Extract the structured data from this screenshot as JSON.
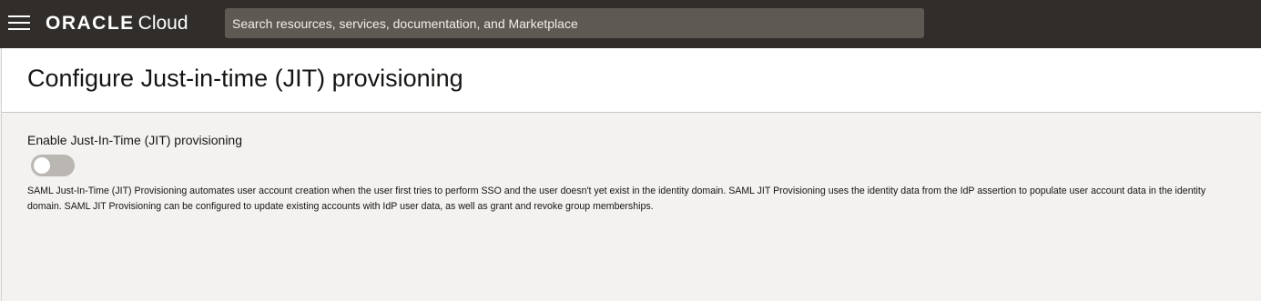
{
  "topbar": {
    "menu_icon": "hamburger-menu-icon",
    "logo_brand": "ORACLE",
    "logo_product": "Cloud",
    "search_placeholder": "Search resources, services, documentation, and Marketplace"
  },
  "page": {
    "title": "Configure Just-in-time (JIT) provisioning"
  },
  "settings": {
    "toggle_label": "Enable Just-In-Time (JIT) provisioning",
    "toggle_enabled": false,
    "description": "SAML Just-In-Time (JIT) Provisioning automates user account creation when the user first tries to perform SSO and the user doesn't yet exist in the identity domain. SAML JIT Provisioning uses the identity data from the IdP assertion to populate user account data in the identity domain. SAML JIT Provisioning can be configured to update existing accounts with IdP user data, as well as grant and revoke group memberships."
  },
  "colors": {
    "topbar_bg": "#312d2a",
    "search_bg": "#5f5953",
    "page_bg": "#f3f2f1",
    "toggle_off": "#bab6b2"
  }
}
